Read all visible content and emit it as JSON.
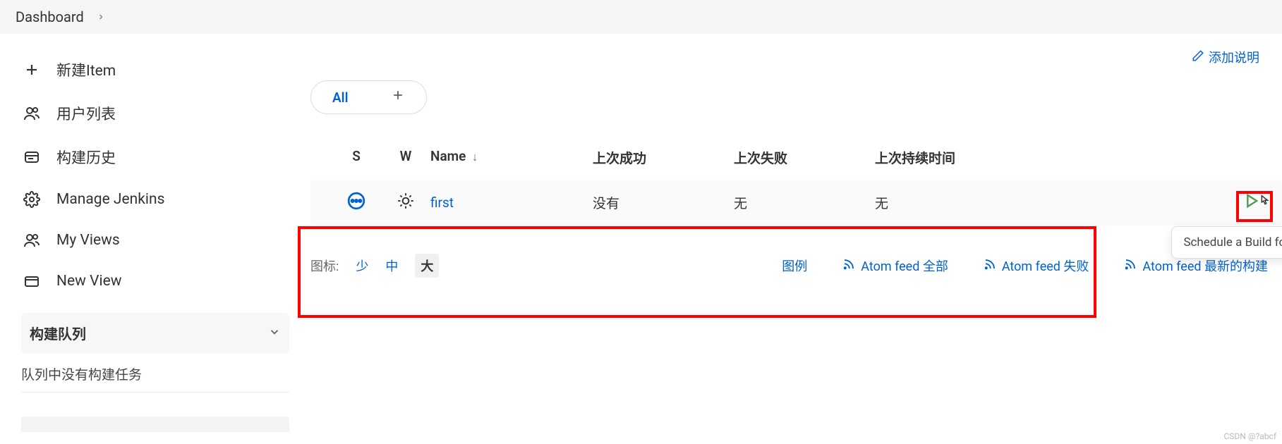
{
  "breadcrumb": {
    "root": "Dashboard"
  },
  "sidebar": {
    "items": [
      {
        "label": "新建Item",
        "icon": "plus"
      },
      {
        "label": "用户列表",
        "icon": "users"
      },
      {
        "label": "构建历史",
        "icon": "history"
      },
      {
        "label": "Manage Jenkins",
        "icon": "gear"
      },
      {
        "label": "My Views",
        "icon": "users"
      },
      {
        "label": "New View",
        "icon": "folder"
      }
    ],
    "queue_section": {
      "title": "构建队列",
      "empty_text": "队列中没有构建任务"
    }
  },
  "content": {
    "add_description": "添加说明",
    "tabs": {
      "all_label": "All"
    },
    "table": {
      "headers": {
        "s": "S",
        "w": "W",
        "name": "Name",
        "last_success": "上次成功",
        "last_fail": "上次失败",
        "last_duration": "上次持续时间"
      },
      "rows": [
        {
          "name": "first",
          "last_success": "没有",
          "last_fail": "无",
          "last_duration": "无"
        }
      ],
      "build_tooltip": "Schedule a Build for"
    },
    "footer": {
      "icon_label": "图标:",
      "sizes": {
        "s": "少",
        "m": "中",
        "l": "大"
      },
      "legend": "图例",
      "feeds": {
        "all": "Atom feed 全部",
        "fail": "Atom feed 失败",
        "latest": "Atom feed 最新的构建"
      }
    }
  },
  "watermark": "CSDN @?abcf"
}
